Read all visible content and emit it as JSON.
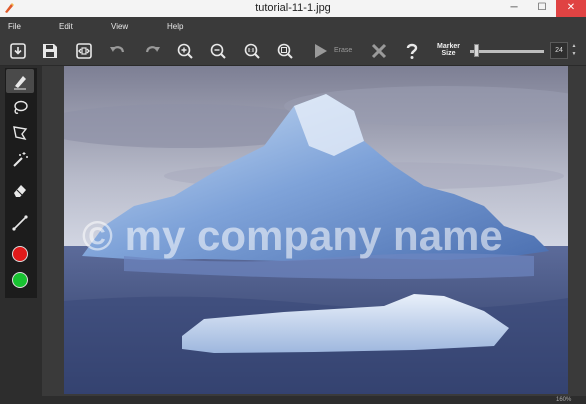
{
  "window": {
    "title": "tutorial-11-1.jpg",
    "minimize": "─",
    "maximize": "☐",
    "close": "✕"
  },
  "menu": [
    "File",
    "Edit",
    "View",
    "Help"
  ],
  "toolbar": {
    "items": [
      "open-icon",
      "save-icon",
      "export-icon",
      "undo-icon",
      "redo-icon",
      "zoom-in-icon",
      "zoom-out-icon",
      "actual-size-icon",
      "fit-icon",
      "play-icon",
      "close-x-icon",
      "help-icon"
    ],
    "erase_label": "Erase",
    "marker_label": "Marker",
    "size_label": "Size",
    "marker_size": "24",
    "marker_size_level": 0.05,
    "spin_up": "▲",
    "spin_down": "▼"
  },
  "tools": [
    "marker-icon",
    "lasso-icon",
    "polygon-lasso-icon",
    "magic-wand-icon",
    "eraser-icon",
    "line-icon"
  ],
  "colors": {
    "foreground": "#e01a1a",
    "background": "#18c231"
  },
  "image": {
    "watermark": "© my company name"
  },
  "status": {
    "zoom": "160%"
  }
}
